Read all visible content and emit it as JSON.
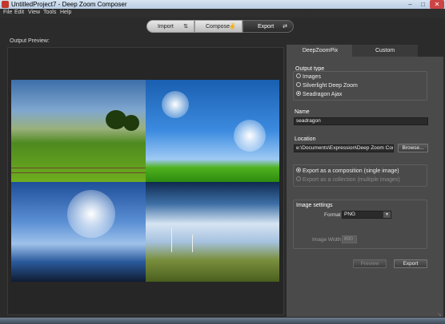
{
  "window": {
    "title": "UntitledProject7 - Deep Zoom Composer",
    "icons": {
      "app": "app-icon",
      "minimize": "minimize-icon",
      "maximize": "maximize-icon",
      "close": "close-icon"
    }
  },
  "menu": [
    "File",
    "Edit",
    "View",
    "Tools",
    "Help"
  ],
  "modes": [
    {
      "label": "Import",
      "icon": "import-icon",
      "active": false
    },
    {
      "label": "Compose",
      "icon": "compose-icon",
      "active": false
    },
    {
      "label": "Export",
      "icon": "export-icon",
      "active": true
    }
  ],
  "preview": {
    "label": "Output Preview:"
  },
  "tabs": [
    {
      "label": "DeepZoomPix",
      "active": false
    },
    {
      "label": "Custom",
      "active": true
    }
  ],
  "output_type": {
    "label": "Output type",
    "options": [
      "Images",
      "Silverlight Deep Zoom",
      "Seadragon Ajax"
    ],
    "selected": "Seadragon Ajax"
  },
  "name": {
    "label": "Name",
    "value": "seadragon"
  },
  "location": {
    "label": "Location",
    "value": "e:\\Documents\\Expression\\Deep Zoom Compos",
    "browse_label": "Browse..."
  },
  "export_as": {
    "options": [
      "Export as a composition (single image)",
      "Export as a collection (multiple images)"
    ],
    "selected": "Export as a composition (single image)"
  },
  "image_settings": {
    "label": "Image settings",
    "format_label": "Format",
    "format_value": "PNG",
    "width_label": "Image Width",
    "width_value": "800"
  },
  "actions": {
    "preview_label": "Preview",
    "export_label": "Export"
  },
  "colors": {
    "panel": "#4a4a4a",
    "background": "#2b2b2b",
    "accent": "#c44444"
  }
}
